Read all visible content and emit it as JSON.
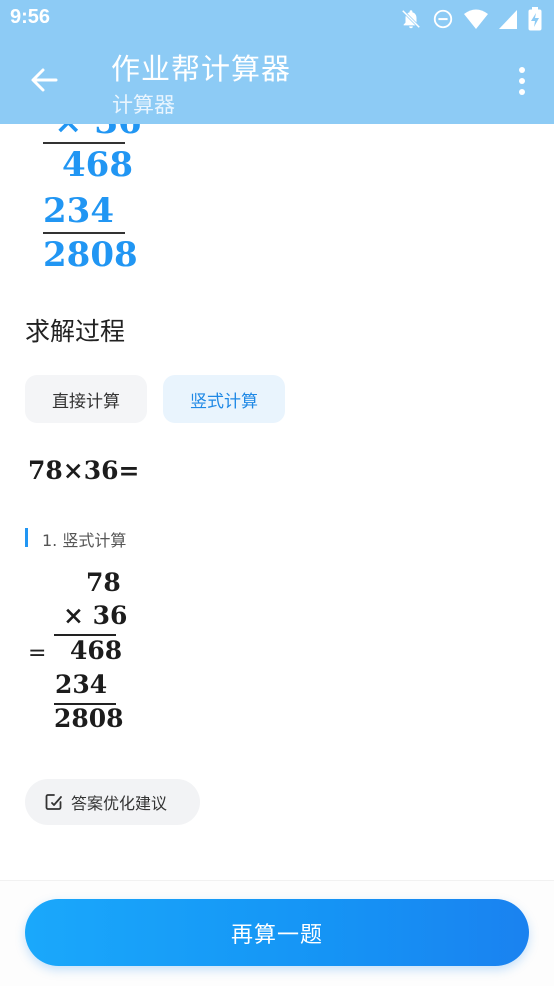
{
  "status_bar": {
    "time": "9:56",
    "icons": [
      "notifications-off-icon",
      "do-not-disturb-icon",
      "wifi-icon",
      "signal-icon",
      "battery-charging-icon"
    ]
  },
  "app_bar": {
    "title": "作业帮计算器",
    "subtitle": "计算器",
    "back_icon": "back-arrow-icon",
    "menu_icon": "more-vert-icon",
    "background": "#8dcbf5"
  },
  "top_vertical_calc": {
    "multiplier_row": "× 36",
    "partial_1": "468",
    "partial_2": "234",
    "result": "2808",
    "color": "#2196f3"
  },
  "solution": {
    "heading": "求解过程",
    "tabs": [
      {
        "label": "直接计算",
        "selected": false
      },
      {
        "label": "竖式计算",
        "selected": true
      }
    ],
    "equation": "78×36=",
    "step_label": "1. 竖式计算",
    "vertical": {
      "equals": "=",
      "multiplicand": "78",
      "multiplier": "× 36",
      "partial_1": "468",
      "partial_2": "234",
      "result": "2808"
    }
  },
  "suggest_button": {
    "label": "答案优化建议",
    "icon": "edit-note-icon"
  },
  "retry_button": {
    "label": "再算一题"
  },
  "colors": {
    "accent": "#2196f3",
    "tab_selected_bg": "#e9f4fd",
    "tab_bg": "#f4f5f7"
  }
}
